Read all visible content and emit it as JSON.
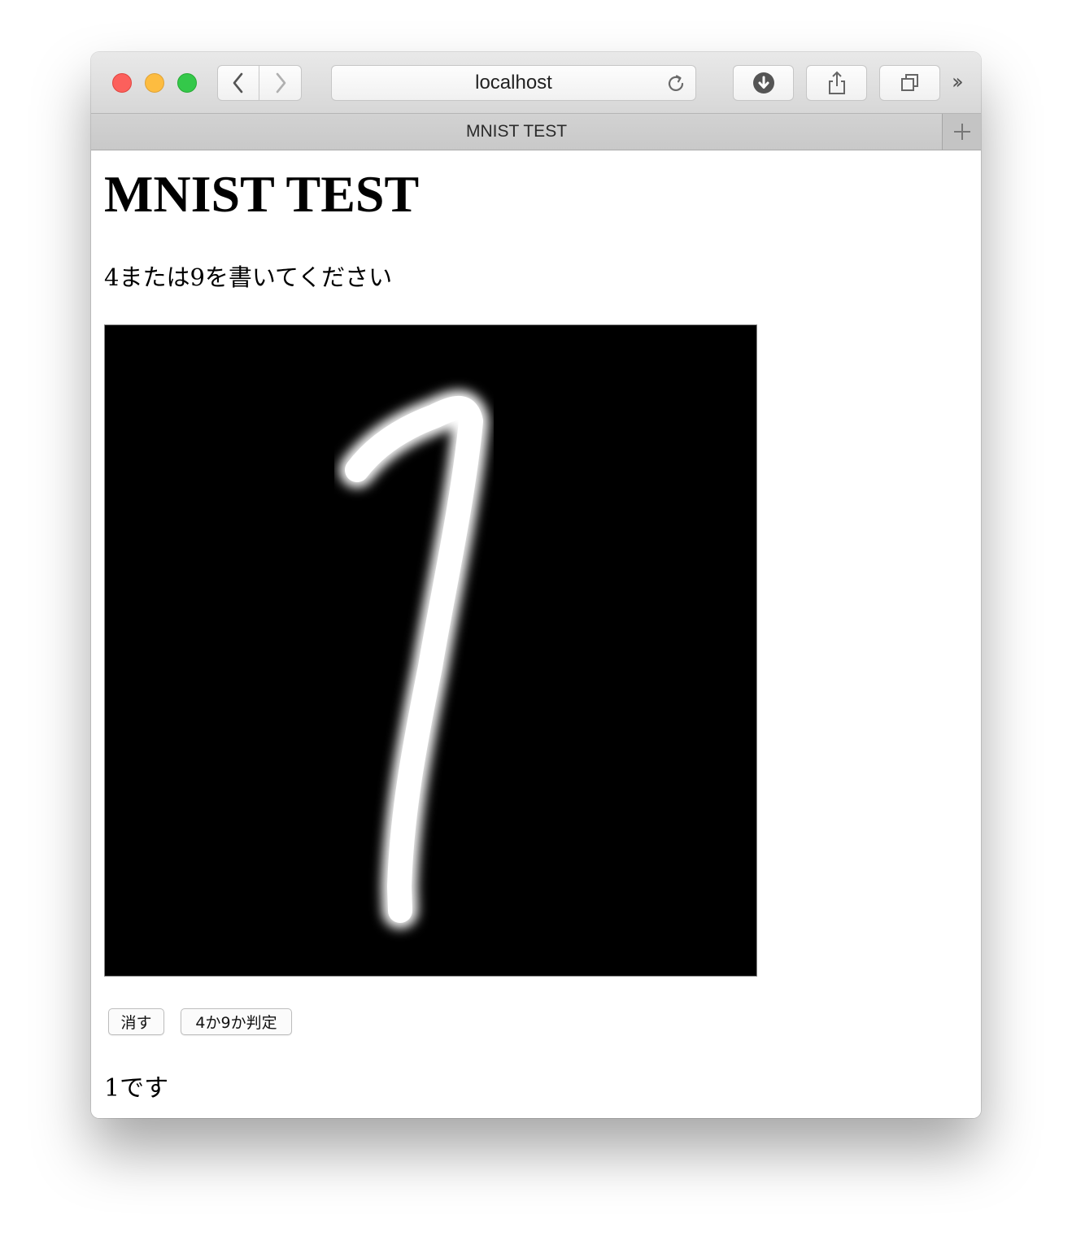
{
  "browser": {
    "url": "localhost",
    "tab_title": "MNIST TEST"
  },
  "page": {
    "heading": "MNIST TEST",
    "instruction": "4または9を書いてください",
    "canvas": {
      "background": "#000000",
      "stroke_color": "#ffffff",
      "drawn_digit": "1"
    },
    "buttons": {
      "erase_label": "消す",
      "judge_label": "4か9か判定"
    },
    "result": "1です"
  },
  "icons": {
    "close": "close-window-icon",
    "minimize": "minimize-window-icon",
    "maximize": "maximize-window-icon",
    "back": "chevron-left-icon",
    "forward": "chevron-right-icon",
    "reload": "reload-icon",
    "downloads": "download-icon",
    "share": "share-icon",
    "tabs": "tabs-icon",
    "more": "double-chevron-right-icon",
    "new_tab": "plus-icon"
  }
}
